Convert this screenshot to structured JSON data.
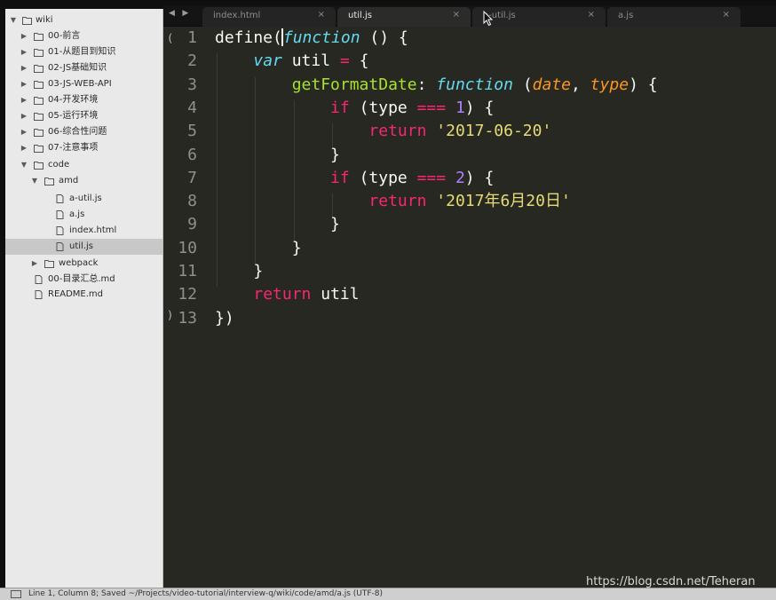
{
  "sidebar": {
    "root": {
      "label": "wiki"
    },
    "folders": [
      {
        "label": "00-前言"
      },
      {
        "label": "01-从题目到知识"
      },
      {
        "label": "02-JS基础知识"
      },
      {
        "label": "03-JS-WEB-API"
      },
      {
        "label": "04-开发环境"
      },
      {
        "label": "05-运行环境"
      },
      {
        "label": "06-综合性问题"
      },
      {
        "label": "07-注意事项"
      }
    ],
    "code_folder": {
      "label": "code"
    },
    "amd_folder": {
      "label": "amd"
    },
    "amd_files": [
      {
        "label": "a-util.js"
      },
      {
        "label": "a.js"
      },
      {
        "label": "index.html"
      },
      {
        "label": "util.js"
      }
    ],
    "webpack_folder": {
      "label": "webpack"
    },
    "root_files": [
      {
        "label": "00-目录汇总.md"
      },
      {
        "label": "README.md"
      }
    ],
    "selected_file": "util.js"
  },
  "tabs": [
    {
      "label": "index.html",
      "close": "×",
      "active": false
    },
    {
      "label": "util.js",
      "close": "×",
      "active": true
    },
    {
      "label": "a-util.js",
      "close": "×",
      "active": false
    },
    {
      "label": "a.js",
      "close": "×",
      "active": false
    }
  ],
  "nav_arrows": "◀ ▶",
  "editor": {
    "line_numbers": [
      "1",
      "2",
      "3",
      "4",
      "5",
      "6",
      "7",
      "8",
      "9",
      "10",
      "11",
      "12",
      "13"
    ],
    "lines": [
      [
        {
          "t": "define(",
          "c": "t-plain"
        },
        {
          "t": "function",
          "c": "t-kw"
        },
        {
          "t": " () {",
          "c": "t-plain"
        }
      ],
      [
        {
          "t": "    ",
          "c": "t-plain"
        },
        {
          "t": "var",
          "c": "t-kw"
        },
        {
          "t": " util ",
          "c": "t-plain"
        },
        {
          "t": "=",
          "c": "t-kw2"
        },
        {
          "t": " {",
          "c": "t-plain"
        }
      ],
      [
        {
          "t": "        ",
          "c": "t-plain"
        },
        {
          "t": "getFormatDate",
          "c": "t-fn"
        },
        {
          "t": ": ",
          "c": "t-plain"
        },
        {
          "t": "function",
          "c": "t-kw"
        },
        {
          "t": " (",
          "c": "t-plain"
        },
        {
          "t": "date",
          "c": "t-param"
        },
        {
          "t": ", ",
          "c": "t-plain"
        },
        {
          "t": "type",
          "c": "t-param"
        },
        {
          "t": ") {",
          "c": "t-plain"
        }
      ],
      [
        {
          "t": "            ",
          "c": "t-plain"
        },
        {
          "t": "if",
          "c": "t-kw2"
        },
        {
          "t": " (type ",
          "c": "t-plain"
        },
        {
          "t": "===",
          "c": "t-kw2"
        },
        {
          "t": " ",
          "c": "t-plain"
        },
        {
          "t": "1",
          "c": "t-num"
        },
        {
          "t": ") {",
          "c": "t-plain"
        }
      ],
      [
        {
          "t": "                ",
          "c": "t-plain"
        },
        {
          "t": "return",
          "c": "t-kw2"
        },
        {
          "t": " ",
          "c": "t-plain"
        },
        {
          "t": "'2017-06-20'",
          "c": "t-str"
        }
      ],
      [
        {
          "t": "            }",
          "c": "t-plain"
        }
      ],
      [
        {
          "t": "            ",
          "c": "t-plain"
        },
        {
          "t": "if",
          "c": "t-kw2"
        },
        {
          "t": " (type ",
          "c": "t-plain"
        },
        {
          "t": "===",
          "c": "t-kw2"
        },
        {
          "t": " ",
          "c": "t-plain"
        },
        {
          "t": "2",
          "c": "t-num"
        },
        {
          "t": ") {",
          "c": "t-plain"
        }
      ],
      [
        {
          "t": "                ",
          "c": "t-plain"
        },
        {
          "t": "return",
          "c": "t-kw2"
        },
        {
          "t": " ",
          "c": "t-plain"
        },
        {
          "t": "'2017年6月20日'",
          "c": "t-str"
        }
      ],
      [
        {
          "t": "            }",
          "c": "t-plain"
        }
      ],
      [
        {
          "t": "        }",
          "c": "t-plain"
        }
      ],
      [
        {
          "t": "    }",
          "c": "t-plain"
        }
      ],
      [
        {
          "t": "    ",
          "c": "t-plain"
        },
        {
          "t": "return",
          "c": "t-kw2"
        },
        {
          "t": " util",
          "c": "t-plain"
        }
      ],
      [
        {
          "t": "})",
          "c": "t-plain"
        }
      ]
    ]
  },
  "statusbar": {
    "text": "Line 1, Column 8; Saved ~/Projects/video-tutorial/interview-q/wiki/code/amd/a.js (UTF-8)"
  },
  "watermark": "https://blog.csdn.net/Teheran",
  "colors": {
    "editor_bg": "#272822",
    "keyword_blue": "#66d9ef",
    "keyword_pink": "#f92672",
    "function_green": "#a6e22e",
    "string_yellow": "#e6db74",
    "number_purple": "#ae81ff",
    "param_orange": "#fd971f"
  }
}
